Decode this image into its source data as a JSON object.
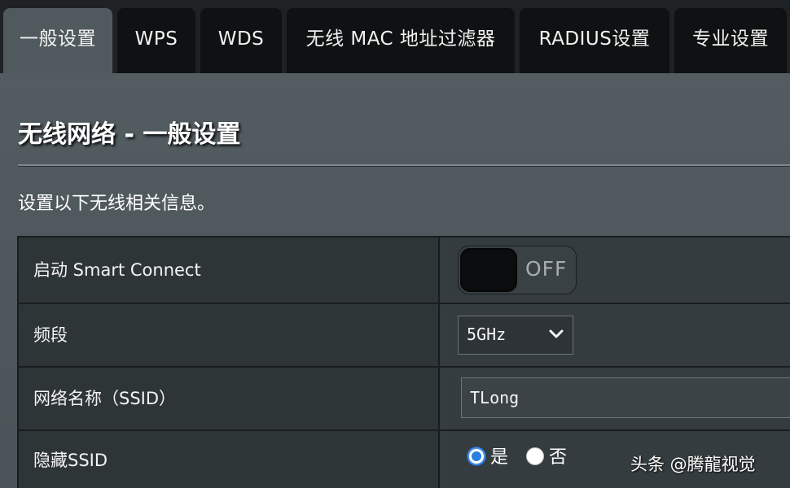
{
  "tabs": [
    {
      "label": "一般设置",
      "active": true
    },
    {
      "label": "WPS",
      "active": false
    },
    {
      "label": "WDS",
      "active": false
    },
    {
      "label": "无线 MAC 地址过滤器",
      "active": false
    },
    {
      "label": "RADIUS设置",
      "active": false
    },
    {
      "label": "专业设置",
      "active": false
    }
  ],
  "panel": {
    "title": "无线网络 - 一般设置",
    "description": "设置以下无线相关信息。"
  },
  "settings": {
    "smart_connect": {
      "label": "启动 Smart Connect",
      "state_text": "OFF"
    },
    "band": {
      "label": "频段",
      "value": "5GHz"
    },
    "ssid": {
      "label": "网络名称（SSID）",
      "value": "TLong"
    },
    "hide_ssid": {
      "label": "隐藏SSID",
      "option_yes": "是",
      "option_no": "否",
      "selected": "是"
    }
  },
  "watermark": "头条 @腾龍视觉",
  "colors": {
    "accent": "#2a7de1",
    "panel": "#505a5e"
  }
}
